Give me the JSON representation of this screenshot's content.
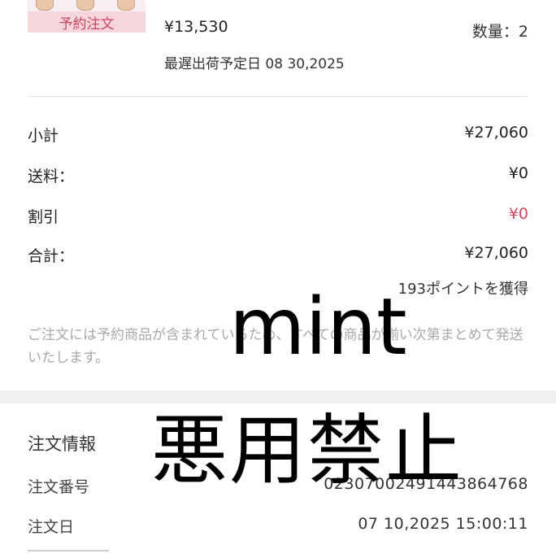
{
  "product": {
    "tag": "予約注文",
    "price": "¥13,530",
    "quantity": "数量：2",
    "ship_date": "最遅出荷予定日 08 30,2025"
  },
  "summary": {
    "subtotal_label": "小計",
    "subtotal_value": "¥27,060",
    "shipping_label": "送料：",
    "shipping_value": "¥0",
    "discount_label": "割引",
    "discount_value": "¥0",
    "total_label": "合計：",
    "total_value": "¥27,060",
    "points": "193ポイントを獲得"
  },
  "note": "ご注文には予約商品が含まれているため、すべての商品が揃い次第まとめて発送いたします。",
  "order_info": {
    "title": "注文情報",
    "number_label": "注文番号",
    "number_value": "0230700249144386476​8",
    "date_label": "注文日",
    "date_value": "07 10,2025 15:00:11"
  },
  "watermarks": {
    "line1": "mint",
    "line2": "悪用禁止"
  },
  "colors": {
    "accent_pink": "#d0485f",
    "tag_bg": "#f5d6dc",
    "note_gray": "#a9a9a9"
  }
}
